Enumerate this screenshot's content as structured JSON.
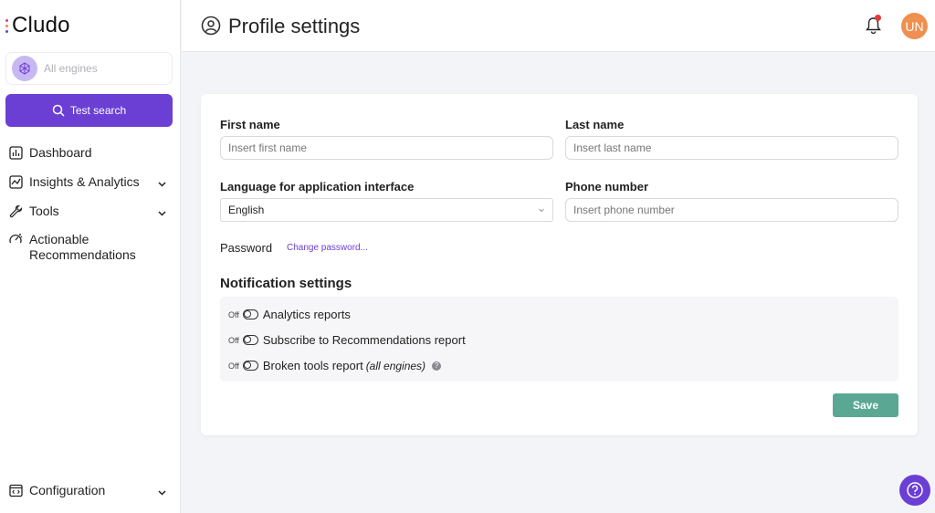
{
  "brand": {
    "name": "Cludo",
    "dot_colors": [
      "#e23b7a",
      "#f08a3a",
      "#6b3fd4"
    ]
  },
  "sidebar": {
    "engine_placeholder": "All engines",
    "test_search_label": "Test search",
    "items": [
      {
        "label": "Dashboard",
        "icon": "bar-chart-icon",
        "has_chevron": false
      },
      {
        "label": "Insights & Analytics",
        "icon": "line-chart-icon",
        "has_chevron": true
      },
      {
        "label": "Tools",
        "icon": "wrench-icon",
        "has_chevron": true
      },
      {
        "label": "Actionable Recommendations",
        "icon": "speedometer-icon",
        "has_chevron": false
      }
    ],
    "config_label": "Configuration"
  },
  "header": {
    "title": "Profile settings",
    "avatar_initials": "UN"
  },
  "form": {
    "first_name_label": "First name",
    "first_name_placeholder": "Insert first name",
    "last_name_label": "Last name",
    "last_name_placeholder": "Insert last name",
    "language_label": "Language for application interface",
    "language_value": "English",
    "phone_label": "Phone number",
    "phone_placeholder": "Insert phone number",
    "password_label": "Password",
    "change_password_link": "Change password..."
  },
  "notifications": {
    "title": "Notification settings",
    "items": [
      {
        "state": "Off",
        "label": "Analytics reports",
        "note": ""
      },
      {
        "state": "Off",
        "label": "Subscribe to Recommendations report",
        "note": ""
      },
      {
        "state": "Off",
        "label": "Broken tools report",
        "note": "(all engines)"
      }
    ]
  },
  "actions": {
    "save_label": "Save"
  },
  "colors": {
    "accent": "#6b3fd4",
    "save": "#5aa894",
    "avatar": "#f0904f",
    "notification_dot": "#e23b3b"
  }
}
